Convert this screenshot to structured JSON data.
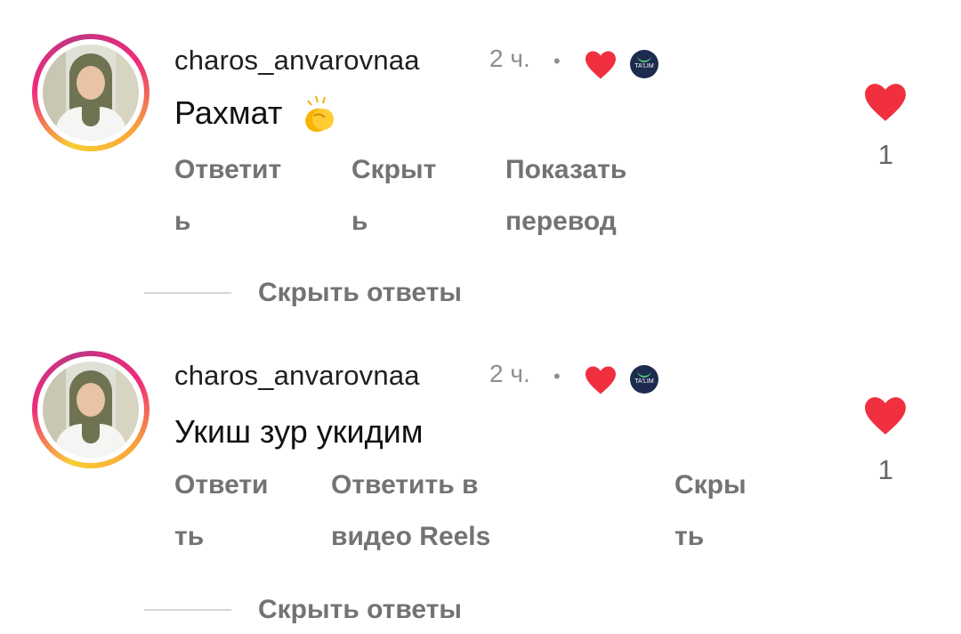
{
  "comments": [
    {
      "username": "charos_anvarovnaa",
      "time": "2 ч.",
      "separator": "•",
      "badge_text": "TA'LIM",
      "text": "Рахмат",
      "emoji": "clapping-hands",
      "actions": [
        "Ответит\nь",
        "Скрыт\nь",
        "Показать\nперевод"
      ],
      "likes": "1",
      "hide_replies": "Скрыть ответы"
    },
    {
      "username": "charos_anvarovnaa",
      "time": "2 ч.",
      "separator": "•",
      "badge_text": "TA'LIM",
      "text": "Укиш зур укидим",
      "actions": [
        "Ответи\nть",
        "Ответить в\nвидео Reels",
        "Скры\nть"
      ],
      "likes": "1",
      "hide_replies": "Скрыть ответы"
    }
  ],
  "colors": {
    "heart": "#f0303f",
    "muted": "#737373",
    "badge": "#1d2b4f"
  }
}
